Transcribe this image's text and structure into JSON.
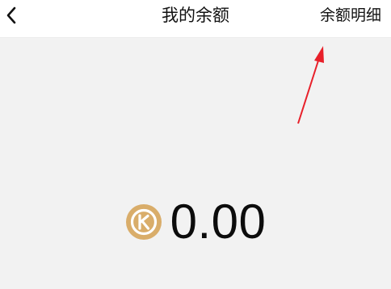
{
  "header": {
    "title": "我的余额",
    "detail_label": "余额明细",
    "back_icon": "chevron-left-icon"
  },
  "balance": {
    "coin_icon": "k-coin-icon",
    "amount": "0.00"
  },
  "colors": {
    "header_background": "#ffffff",
    "page_background": "#f2f2f2",
    "coin_gold": "#d9ad6a",
    "annotation_arrow": "#e8202a"
  }
}
